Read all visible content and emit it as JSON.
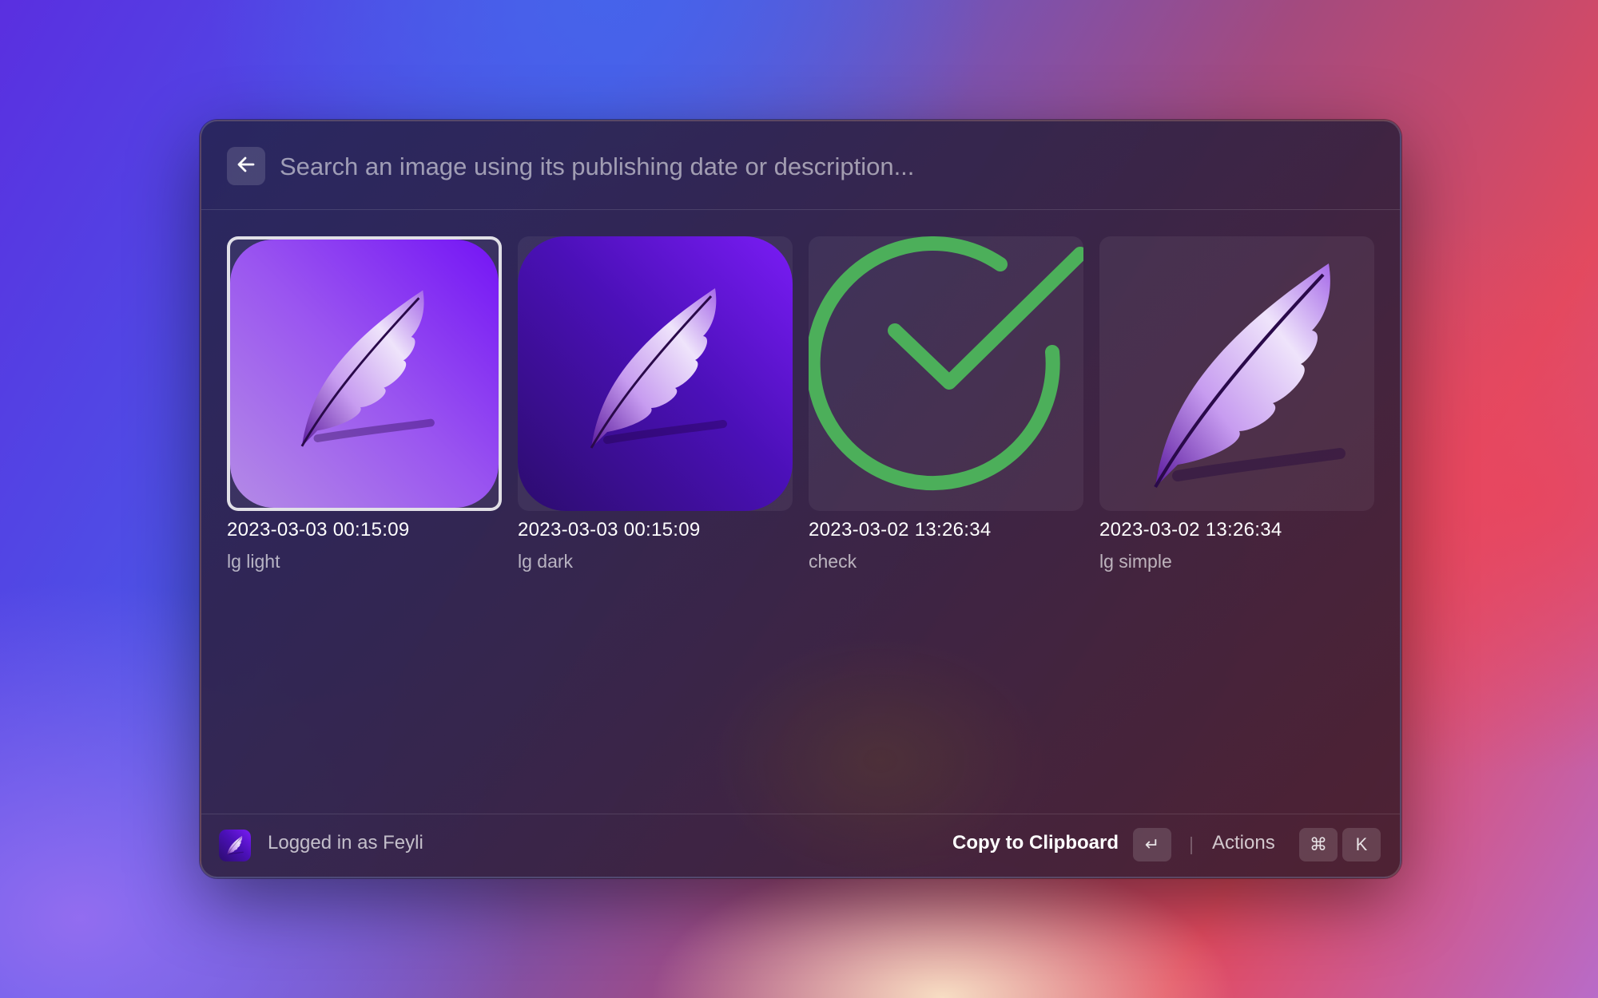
{
  "search": {
    "placeholder": "Search an image using its publishing date or description..."
  },
  "images": [
    {
      "date": "2023-03-03 00:15:09",
      "description": "lg light",
      "icon": "feather-light-icon",
      "selected": true
    },
    {
      "date": "2023-03-03 00:15:09",
      "description": "lg dark",
      "icon": "feather-dark-icon",
      "selected": false
    },
    {
      "date": "2023-03-02 13:26:34",
      "description": "check",
      "icon": "check-circle-icon",
      "selected": false
    },
    {
      "date": "2023-03-02 13:26:34",
      "description": "lg simple",
      "icon": "feather-simple-icon",
      "selected": false
    }
  ],
  "footer": {
    "status": "Logged in as Feyli",
    "primary_action": "Copy to Clipboard",
    "enter_key": "↵",
    "actions_label": "Actions",
    "cmd_key": "⌘",
    "k_key": "K"
  },
  "colors": {
    "accent_purple": "#7b2ff7",
    "check_green": "#4caf5a"
  }
}
